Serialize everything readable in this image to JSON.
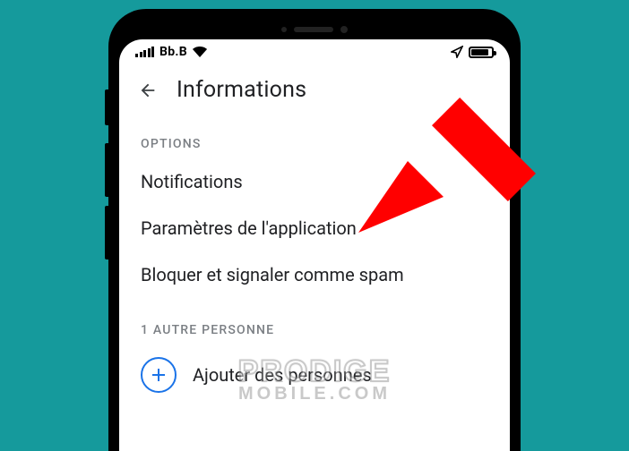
{
  "status": {
    "carrier": "Bb.B"
  },
  "appbar": {
    "title": "Informations"
  },
  "options": {
    "label": "OPTIONS",
    "items": [
      "Notifications",
      "Paramètres de l'application",
      "Bloquer et signaler comme spam"
    ]
  },
  "people": {
    "label": "1 AUTRE PERSONNE",
    "add_label": "Ajouter des personnes"
  },
  "watermark": {
    "line1": "PRODIGE",
    "line2": "MOBILE.COM"
  },
  "annotation": {
    "arrow_color": "#ff0000"
  }
}
